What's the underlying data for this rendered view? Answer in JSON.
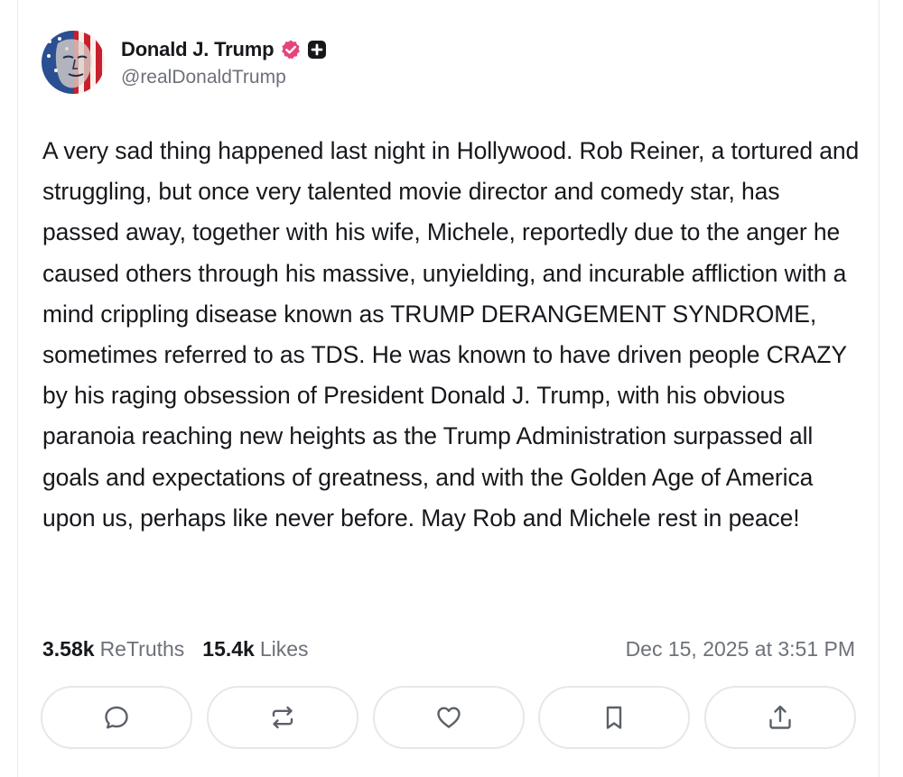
{
  "author": {
    "display_name": "Donald J. Trump",
    "handle": "@realDonaldTrump",
    "verified_color": "#e5457a",
    "badge_color": "#16181c"
  },
  "post": {
    "text": "A very sad thing happened last night in Hollywood. Rob Reiner, a tortured and struggling, but once very talented movie director and comedy star, has passed away, together with his wife, Michele, reportedly due to the anger he caused others through his massive, unyielding, and incurable affliction with a mind crippling disease known as TRUMP DERANGEMENT SYNDROME, sometimes referred to as TDS. He was known to have driven people CRAZY by his raging obsession of President Donald J. Trump, with his obvious paranoia reaching new heights as the Trump Administration surpassed all goals and expectations of greatness, and with the Golden Age of America upon us, perhaps like never before. May Rob and Michele rest in peace!"
  },
  "stats": {
    "retruths_count": "3.58k",
    "retruths_label": "ReTruths",
    "likes_count": "15.4k",
    "likes_label": "Likes",
    "timestamp": "Dec 15, 2025 at 3:51 PM"
  },
  "actions": [
    {
      "name": "reply",
      "icon": "comment-icon"
    },
    {
      "name": "retruth",
      "icon": "repost-icon"
    },
    {
      "name": "like",
      "icon": "heart-icon"
    },
    {
      "name": "bookmark",
      "icon": "bookmark-icon"
    },
    {
      "name": "share",
      "icon": "share-icon"
    }
  ],
  "colors": {
    "text_primary": "#16181c",
    "text_secondary": "#6d7179",
    "border": "#e6e7ea",
    "icon": "#5c6069"
  }
}
